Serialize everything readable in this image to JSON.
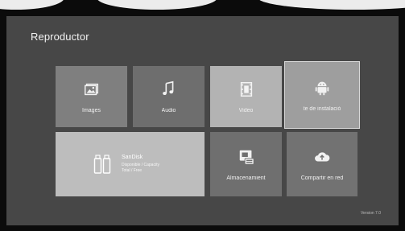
{
  "title": "Reproductor",
  "tiles": {
    "images": {
      "label": "Images",
      "icon": "image-icon",
      "color": "#7f7f7f"
    },
    "audio": {
      "label": "Audio",
      "icon": "music-note-icon",
      "color": "#6e6e6e"
    },
    "video": {
      "label": "Video",
      "icon": "film-icon",
      "color": "#b3b3b3"
    },
    "install": {
      "label": "te de instalació",
      "icon": "android-icon",
      "color": "#9e9e9e"
    },
    "storage_mgr": {
      "label": "Almacenamient",
      "icon": "storage-icon",
      "color": "#6f6f6f"
    },
    "share": {
      "label": "Compartir en red",
      "icon": "cloud-upload-icon",
      "color": "#727272"
    }
  },
  "storage_device": {
    "name": "SanDisk",
    "line1": "Disponible / Capacity",
    "line2": "Total / Free",
    "icon": "usb-storage-icon",
    "color": "#bdbdbd"
  },
  "version": "Version 7.0"
}
